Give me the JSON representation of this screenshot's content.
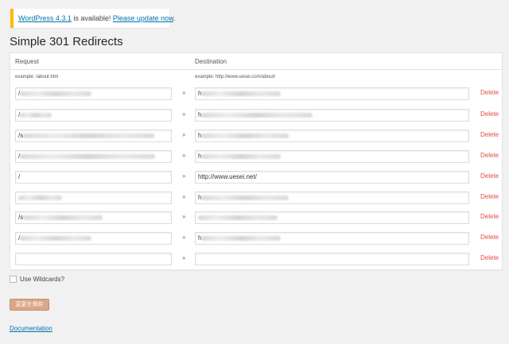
{
  "notice": {
    "update_link": "WordPress 4.3.1",
    "middle_text": " is available! ",
    "please_link": "Please update now",
    "end_text": "."
  },
  "title": "Simple 301 Redirects",
  "table": {
    "col_request": "Request",
    "col_destination": "Destination",
    "example_request": "example: /about.htm",
    "example_destination": "example: http://www.uesei.com/about/",
    "arrow": "»",
    "delete_label": "Delete",
    "rows": [
      {
        "request": "/",
        "destination": "h"
      },
      {
        "request": "/",
        "destination": "h"
      },
      {
        "request": "/s",
        "destination": "h"
      },
      {
        "request": "/",
        "destination": "h"
      },
      {
        "request": "/",
        "destination": "http://www.uesei.net/"
      },
      {
        "request": "",
        "destination": "h"
      },
      {
        "request": "/s",
        "destination": ""
      },
      {
        "request": "/",
        "destination": "h"
      },
      {
        "request": "",
        "destination": ""
      }
    ]
  },
  "wildcards_label": "Use Wildcards?",
  "save_label": "変更を保存",
  "documentation_label": "Documentation"
}
